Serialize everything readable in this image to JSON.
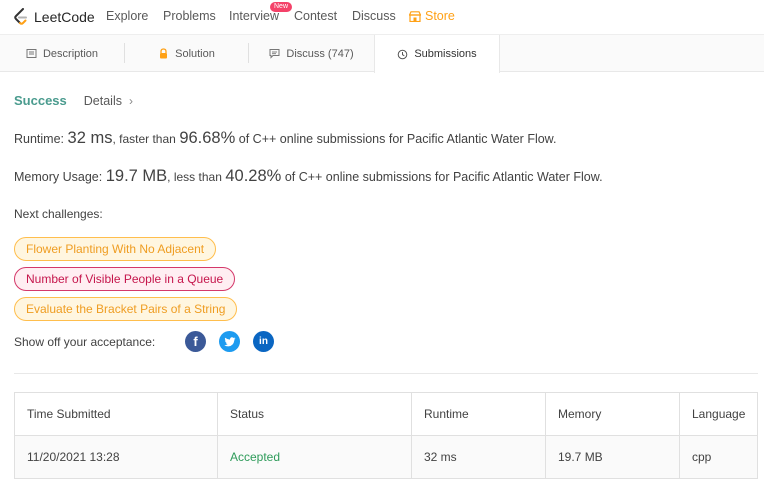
{
  "nav": {
    "logo_text": "LeetCode",
    "items": [
      "Explore",
      "Problems",
      "Interview",
      "Contest",
      "Discuss"
    ],
    "new_badge": "New",
    "store": "Store",
    "store_color": "#ffa116"
  },
  "tabs": [
    {
      "label": "Description",
      "icon": "description-icon"
    },
    {
      "label": "Solution",
      "icon": "lock-icon"
    },
    {
      "label": "Discuss (747)",
      "icon": "discuss-icon"
    },
    {
      "label": "Submissions",
      "icon": "clock-icon",
      "active": true
    }
  ],
  "result": {
    "status": "Success",
    "details": "Details",
    "runtime_label": "Runtime:",
    "runtime_value": "32 ms",
    "runtime_compare": ", faster than",
    "runtime_percent": "96.68%",
    "runtime_suffix": "of C++ online submissions for Pacific Atlantic Water Flow.",
    "memory_label": "Memory Usage:",
    "memory_value": "19.7 MB",
    "memory_compare": ", less than",
    "memory_percent": "40.28%",
    "memory_suffix": "of C++ online submissions for Pacific Atlantic Water Flow."
  },
  "next": {
    "label": "Next challenges:",
    "challenges": [
      {
        "title": "Flower Planting With No Adjacent",
        "difficulty": "easy"
      },
      {
        "title": "Number of Visible People in a Queue",
        "difficulty": "medium"
      },
      {
        "title": "Evaluate the Bracket Pairs of a String",
        "difficulty": "easy"
      }
    ]
  },
  "share": {
    "label": "Show off your acceptance:",
    "icons": [
      "facebook-icon",
      "twitter-icon",
      "linkedin-icon"
    ]
  },
  "table": {
    "headers": [
      "Time Submitted",
      "Status",
      "Runtime",
      "Memory",
      "Language"
    ],
    "rows": [
      [
        "11/20/2021 13:28",
        "Accepted",
        "32 ms",
        "19.7 MB",
        "cpp"
      ]
    ]
  }
}
